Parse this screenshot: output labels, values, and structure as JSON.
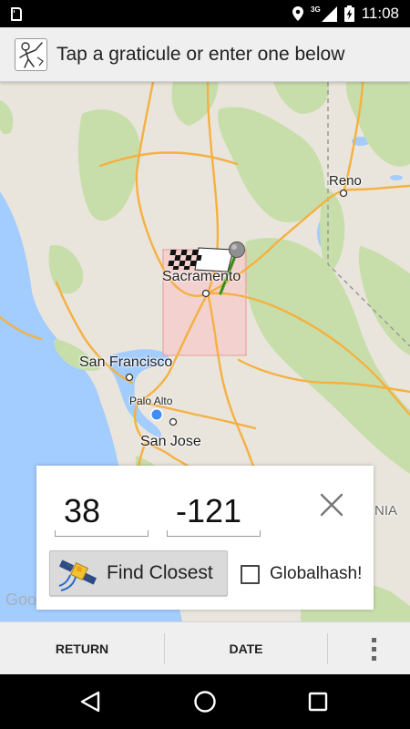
{
  "status_bar": {
    "network_label": "3G",
    "time": "11:08",
    "icons": [
      "sd-card-icon",
      "location-icon",
      "signal-icon",
      "battery-charging-icon"
    ]
  },
  "action_bar": {
    "title": "Tap a graticule or enter one below",
    "app_icon": "geohash-stick-figure-icon"
  },
  "map": {
    "labels": {
      "reno": "Reno",
      "sacramento": "Sacramento",
      "san_francisco": "San Francisco",
      "palo_alto": "Palo Alto",
      "san_jose": "San Jose",
      "nia": "NIA"
    },
    "attribution": "Google",
    "marker": "checkered-flag-pin-icon",
    "colors": {
      "water": "#a3ccff",
      "land": "#e9e5dc",
      "park": "#c8deaa",
      "highway": "#f4b142",
      "graticule_fill": "#f7c9c9",
      "graticule_stroke": "#e8a3a3",
      "my_location": "#3f8ef5"
    }
  },
  "graticule_input": {
    "latitude": "38",
    "longitude": "-121",
    "find_button_label": "Find Closest",
    "find_button_icon": "satellite-icon",
    "globalhash_label": "Globalhash!",
    "globalhash_checked": false
  },
  "bottom_bar": {
    "return_label": "RETURN",
    "date_label": "DATE"
  },
  "nav_bar": {
    "icons": [
      "back-icon",
      "home-icon",
      "recents-icon"
    ]
  }
}
